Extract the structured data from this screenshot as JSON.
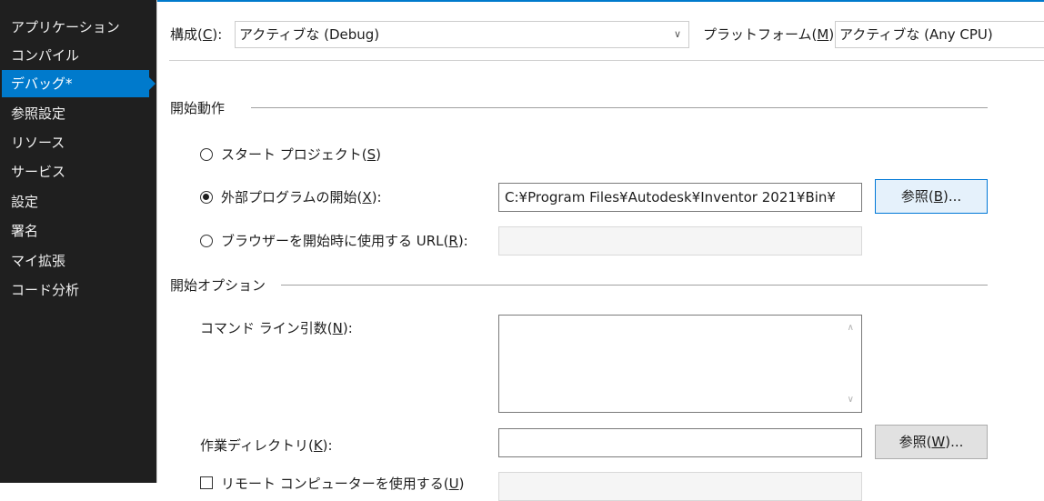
{
  "sidebar": {
    "items": [
      {
        "label": "アプリケーション"
      },
      {
        "label": "コンパイル"
      },
      {
        "label": "デバッグ*"
      },
      {
        "label": "参照設定"
      },
      {
        "label": "リソース"
      },
      {
        "label": "サービス"
      },
      {
        "label": "設定"
      },
      {
        "label": "署名"
      },
      {
        "label": "マイ拡張"
      },
      {
        "label": "コード分析"
      }
    ],
    "selected": "デバッグ*"
  },
  "config": {
    "label_pre": "構成(",
    "label_key": "C",
    "label_post": "):",
    "value": "アクティブな (Debug)"
  },
  "platform": {
    "label_pre": "プラットフォーム(",
    "label_key": "M",
    "label_post": "):",
    "value": "アクティブな (Any CPU)"
  },
  "start_action": {
    "header": "開始動作",
    "start_project": {
      "pre": "スタート プロジェクト(",
      "key": "S",
      "post": ")"
    },
    "external_program": {
      "pre": "外部プログラムの開始(",
      "key": "X",
      "post": "):",
      "value": "C:¥Program Files¥Autodesk¥Inventor 2021¥Bin¥"
    },
    "browser_url": {
      "pre": "ブラウザーを開始時に使用する URL(",
      "key": "R",
      "post": "):",
      "value": ""
    },
    "browse1": {
      "pre": "参照(",
      "key": "B",
      "post": ")..."
    }
  },
  "start_options": {
    "header": "開始オプション",
    "command_line": {
      "pre": "コマンド ライン引数(",
      "key": "N",
      "post": "):",
      "value": ""
    },
    "working_dir": {
      "pre": "作業ディレクトリ(",
      "key": "K",
      "post": "):",
      "value": ""
    },
    "browse2": {
      "pre": "参照(",
      "key": "W",
      "post": ")..."
    },
    "remote_machine": {
      "pre": "リモート コンピューターを使用する(",
      "key": "U",
      "post": ")"
    }
  },
  "colors": {
    "accent": "#007acc",
    "sidebar_bg": "#1f1f1f",
    "focus_border": "#0078d7"
  },
  "icons": {
    "dropdown": "chevron-down-icon",
    "scroll_up": "scroll-up-icon",
    "scroll_down": "scroll-down-icon"
  }
}
